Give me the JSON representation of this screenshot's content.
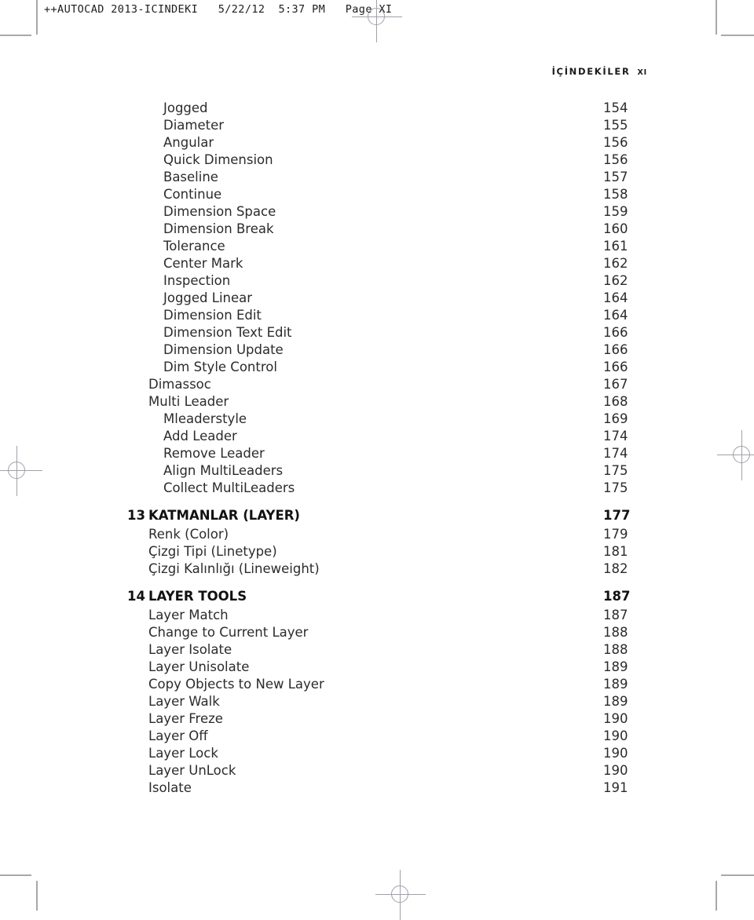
{
  "slug": "++AUTOCAD 2013-ICINDEKI   5/22/12  5:37 PM   Page XI",
  "running_head": {
    "title": "İÇİNDEKİLER",
    "folio": "XI"
  },
  "toc": {
    "entries": [
      {
        "level": 2,
        "label": "Jogged",
        "page": "154"
      },
      {
        "level": 2,
        "label": "Diameter",
        "page": "155"
      },
      {
        "level": 2,
        "label": "Angular",
        "page": "156"
      },
      {
        "level": 2,
        "label": "Quick Dimension",
        "page": "156"
      },
      {
        "level": 2,
        "label": "Baseline",
        "page": "157"
      },
      {
        "level": 2,
        "label": "Continue",
        "page": "158"
      },
      {
        "level": 2,
        "label": "Dimension Space",
        "page": "159"
      },
      {
        "level": 2,
        "label": "Dimension Break",
        "page": "160"
      },
      {
        "level": 2,
        "label": "Tolerance",
        "page": "161"
      },
      {
        "level": 2,
        "label": "Center Mark",
        "page": "162"
      },
      {
        "level": 2,
        "label": "Inspection",
        "page": "162"
      },
      {
        "level": 2,
        "label": "Jogged Linear",
        "page": "164"
      },
      {
        "level": 2,
        "label": "Dimension Edit",
        "page": "164"
      },
      {
        "level": 2,
        "label": "Dimension Text Edit",
        "page": "166"
      },
      {
        "level": 2,
        "label": "Dimension Update",
        "page": "166"
      },
      {
        "level": 2,
        "label": "Dim Style Control",
        "page": "166"
      },
      {
        "level": 1,
        "label": "Dimassoc",
        "page": "167"
      },
      {
        "level": 1,
        "label": "Multi Leader",
        "page": "168"
      },
      {
        "level": 2,
        "label": "Mleaderstyle",
        "page": "169"
      },
      {
        "level": 2,
        "label": "Add Leader",
        "page": "174"
      },
      {
        "level": 2,
        "label": "Remove Leader",
        "page": "174"
      },
      {
        "level": 2,
        "label": "Align MultiLeaders",
        "page": "175"
      },
      {
        "level": 2,
        "label": "Collect MultiLeaders",
        "page": "175"
      },
      {
        "level": "chapter",
        "number": "13",
        "label": "KATMANLAR (LAYER)",
        "page": "177"
      },
      {
        "level": 1,
        "label": "Renk (Color)",
        "page": "179"
      },
      {
        "level": 1,
        "label": "Çizgi Tipi (Linetype)",
        "page": "181"
      },
      {
        "level": 1,
        "label": "Çizgi Kalınlığı (Lineweight)",
        "page": "182"
      },
      {
        "level": "chapter",
        "number": "14",
        "label": "LAYER TOOLS",
        "page": "187"
      },
      {
        "level": 1,
        "label": "Layer Match",
        "page": "187"
      },
      {
        "level": 1,
        "label": "Change to Current Layer",
        "page": "188"
      },
      {
        "level": 1,
        "label": "Layer Isolate",
        "page": "188"
      },
      {
        "level": 1,
        "label": "Layer Unisolate",
        "page": "189"
      },
      {
        "level": 1,
        "label": "Copy Objects to New Layer",
        "page": "189"
      },
      {
        "level": 1,
        "label": "Layer Walk",
        "page": "189"
      },
      {
        "level": 1,
        "label": "Layer Freze",
        "page": "190"
      },
      {
        "level": 1,
        "label": "Layer Off",
        "page": "190"
      },
      {
        "level": 1,
        "label": "Layer Lock",
        "page": "190"
      },
      {
        "level": 1,
        "label": "Layer UnLock",
        "page": "190"
      },
      {
        "level": 1,
        "label": "Isolate",
        "page": "191"
      }
    ]
  },
  "print_marks": {
    "crop_mark_color": "#a8a8a8",
    "registration_mark_color": "#a0a0a8"
  }
}
